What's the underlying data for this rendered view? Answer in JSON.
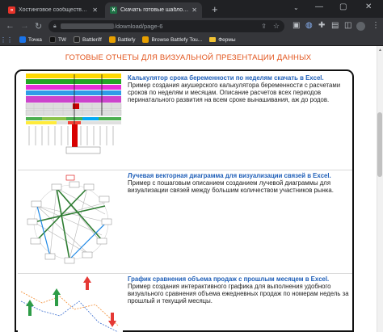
{
  "tabs": [
    {
      "label": "Хостинговое сообщество «Tim»",
      "favicon": "red-square-icon",
      "active": false
    },
    {
      "label": "Скачать готовые шаблоны раб",
      "favicon": "excel-icon",
      "active": true
    }
  ],
  "address": {
    "path": "/download/page-6"
  },
  "bookmarks": [
    {
      "label": "Точка",
      "icon": "blue-square-icon"
    },
    {
      "label": "TW",
      "icon": "tw-icon"
    },
    {
      "label": "Battleriff",
      "icon": "battleriff-icon"
    },
    {
      "label": "Battlefy",
      "icon": "battlefy-icon"
    },
    {
      "label": "Browse Battlefy Tou...",
      "icon": "battlefy-icon"
    },
    {
      "label": "Фермы",
      "icon": "folder-icon"
    }
  ],
  "page": {
    "heading": "ГОТОВЫЕ ОТЧЕТЫ ДЛЯ ВИЗУАЛЬНОЙ ПРЕЗЕНТАЦИИ ДАННЫХ",
    "items": [
      {
        "title": "Калькулятор срока беременности по неделям скачать в Excel.",
        "text": "Пример создания акушерского калькулятора беременности с расчетами сроков по неделям и месяцам. Описание расчетов всех периодов перинатального развития на всем сроке вынашивания, аж до родов."
      },
      {
        "title": "Лучевая векторная диаграмма для визуализации связей в Excel.",
        "text": "Пример с пошаговым описанием созданием лучевой диаграммы для визуализации связей между большим количеством участников рынка."
      },
      {
        "title": "График сравнения объема продаж с прошлым месяцем в Excel.",
        "text": "Пример создания интерактивного графика для выполнения удобного визуального сравнения объема ежедневных продаж по номерам недель за прошлый и текущий месяцы."
      }
    ]
  },
  "colors": {
    "heading": "#e2541c",
    "link": "#1f5fb8",
    "frame": "#111111"
  }
}
